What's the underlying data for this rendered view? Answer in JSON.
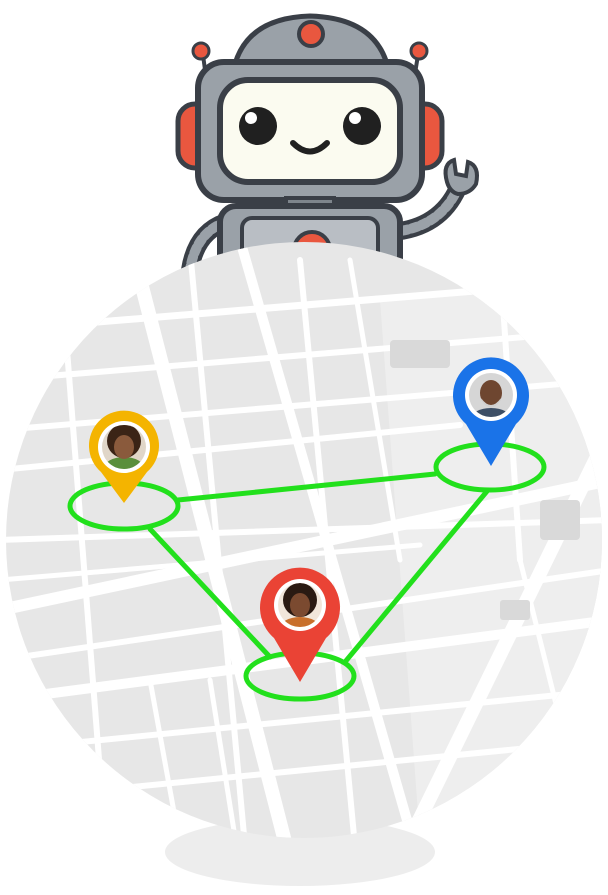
{
  "robot": {
    "name": "waving-robot",
    "colors": {
      "body": "#9aa1a8",
      "body_light": "#b9bec4",
      "outline": "#3a3f47",
      "accent": "#e9573f",
      "screen": "#fbfbf0",
      "eyes": "#202020"
    }
  },
  "map": {
    "colors": {
      "land": "#e7e7e7",
      "roads": "#ffffff",
      "shadow": "#ededed"
    }
  },
  "route": {
    "color": "#22e01c"
  },
  "pins": [
    {
      "id": "yellow",
      "color": "#f4b400",
      "avatar_skin": "#8a5a3c",
      "avatar_hair": "#3b2416",
      "avatar_shirt": "#5a8f3c"
    },
    {
      "id": "blue",
      "color": "#1a73e8",
      "avatar_skin": "#6e4630",
      "avatar_hair": "#cfcfcf",
      "avatar_shirt": "#3d4f66"
    },
    {
      "id": "red",
      "color": "#ea4335",
      "avatar_skin": "#7b4a30",
      "avatar_hair": "#2a1a12",
      "avatar_shirt": "#c8702c"
    }
  ]
}
